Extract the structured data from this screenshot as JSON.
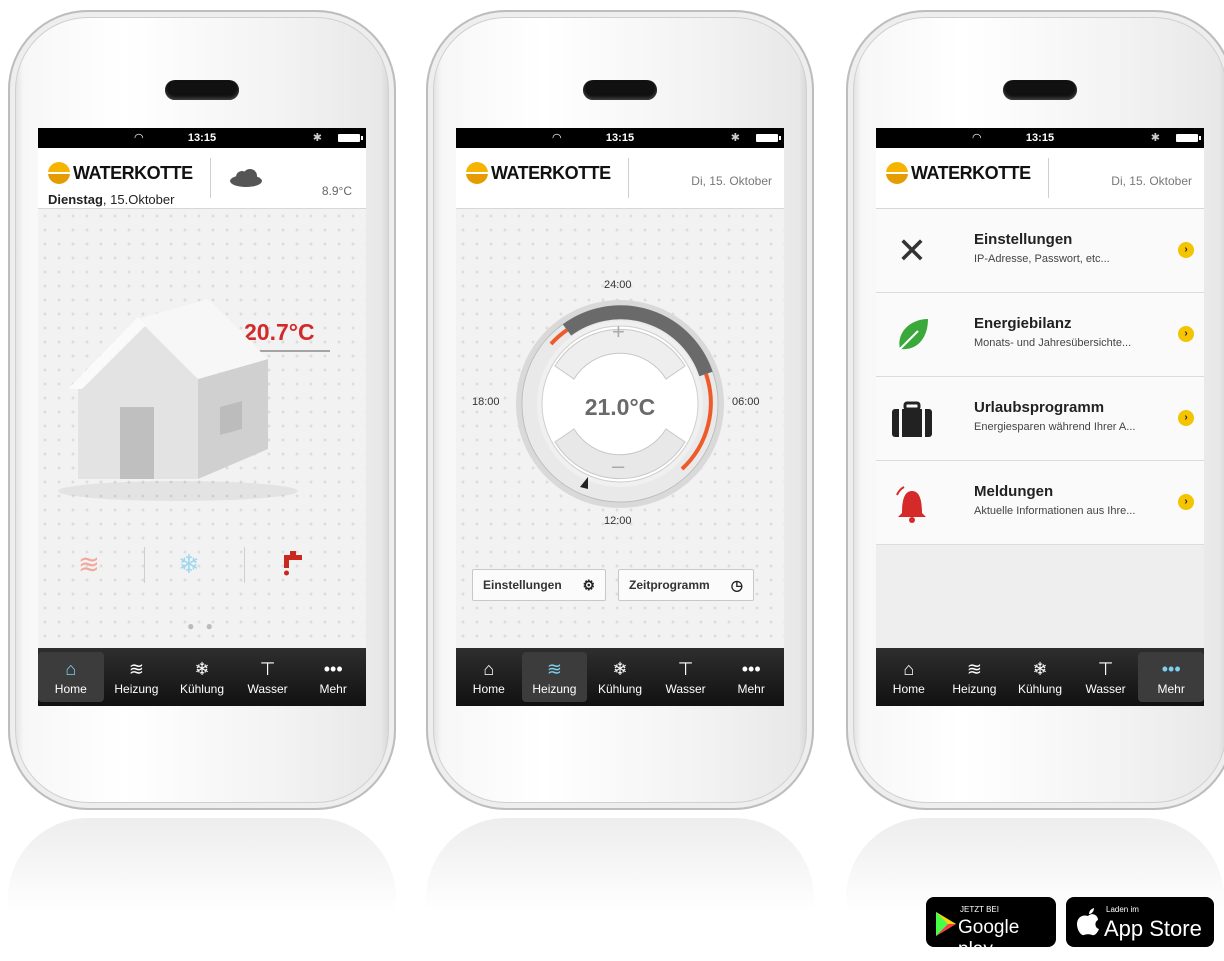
{
  "status": {
    "time": "13:15"
  },
  "brand": "WATERKOTTE",
  "screen1": {
    "day": "Dienstag",
    "date": ", 15.Oktober",
    "outside_temp": "8.9°C",
    "inside_temp": "20.7°C",
    "pager": "● ●"
  },
  "screen2": {
    "date": "Di, 15. Oktober",
    "labels": {
      "top": "24:00",
      "left": "18:00",
      "right": "06:00",
      "bottom": "12:00"
    },
    "setpoint": "21.0°C",
    "plus": "+",
    "minus": "–",
    "btn_settings": "Einstellungen",
    "btn_schedule": "Zeitprogramm"
  },
  "screen3": {
    "date": "Di, 15. Oktober",
    "menu": [
      {
        "title": "Einstellungen",
        "subtitle": "IP-Adresse, Passwort, etc...",
        "icon": "tools-icon"
      },
      {
        "title": "Energiebilanz",
        "subtitle": "Monats- und Jahresübersichte...",
        "icon": "leaf-icon"
      },
      {
        "title": "Urlaubsprogramm",
        "subtitle": "Energiesparen während Ihrer A...",
        "icon": "suitcase-icon"
      },
      {
        "title": "Meldungen",
        "subtitle": "Aktuelle Informationen aus Ihre...",
        "icon": "bell-icon"
      }
    ]
  },
  "tabs": [
    "Home",
    "Heizung",
    "Kühlung",
    "Wasser",
    "Mehr"
  ],
  "badges": {
    "google_small": "JETZT BEI",
    "google_big": "Google play",
    "apple_small": "Laden im",
    "apple_big": "App Store"
  },
  "colors": {
    "accent_red": "#d22a2a",
    "accent_yellow": "#f4c400",
    "tab_active_blue": "#7ed0f0",
    "leaf_green": "#3aa83a"
  }
}
